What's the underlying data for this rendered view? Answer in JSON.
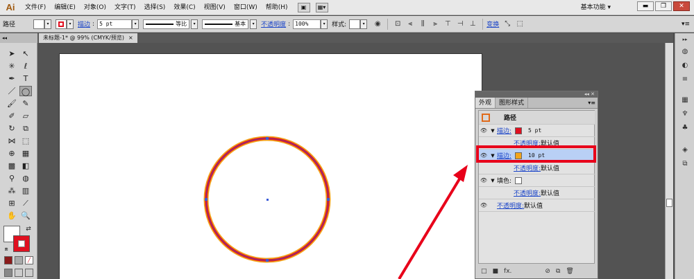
{
  "app": {
    "logo": "Ai",
    "workspace": "基本功能",
    "workspace_caret": "▾"
  },
  "menu": [
    "文件(F)",
    "编辑(E)",
    "对象(O)",
    "文字(T)",
    "选择(S)",
    "效果(C)",
    "视图(V)",
    "窗口(W)",
    "帮助(H)"
  ],
  "window_buttons": [
    "▬",
    "❐",
    "✕"
  ],
  "control": {
    "path_label": "路径",
    "stroke_link": "描边",
    "stroke_weight": "5 pt",
    "profile_label": "等比",
    "brush_label": "基本",
    "opacity_link": "不透明度",
    "opacity_value": "100%",
    "style_label": "样式:",
    "transform_link": "变换",
    "panel_menu": "▾≡"
  },
  "tab": {
    "title": "未标题-1* @ 99% (CMYK/预览)",
    "close": "×"
  },
  "artwork": {
    "outer_stroke_color": "#f2a51d",
    "inner_stroke_color": "#e01020",
    "anchor_color": "#3a5cd8"
  },
  "panel": {
    "grip": "◂◂ ✕",
    "tabs": [
      "外观",
      "图形样式"
    ],
    "menu_icon": "▾≡",
    "title": "路径",
    "rows": [
      {
        "link": "描边:",
        "chip": "#e01020",
        "value": "5 pt"
      },
      {
        "link": "不透明度:",
        "value": "默认值"
      },
      {
        "link": "描边:",
        "chip": "#f2a51d",
        "value": "10 pt"
      },
      {
        "link": "不透明度:",
        "value": "默认值"
      },
      {
        "label": "填色:",
        "chip": "#ffffff"
      },
      {
        "link": "不透明度:",
        "value": "默认值"
      },
      {
        "link": "不透明度:",
        "value": "默认值"
      }
    ],
    "footer_icons": [
      "□",
      "■",
      "fx.",
      "⊘",
      "⧉",
      "🗑"
    ]
  },
  "colors": {
    "highlight_box": "#e8001a",
    "arrow": "#e8001a",
    "link": "#1a44c8"
  }
}
